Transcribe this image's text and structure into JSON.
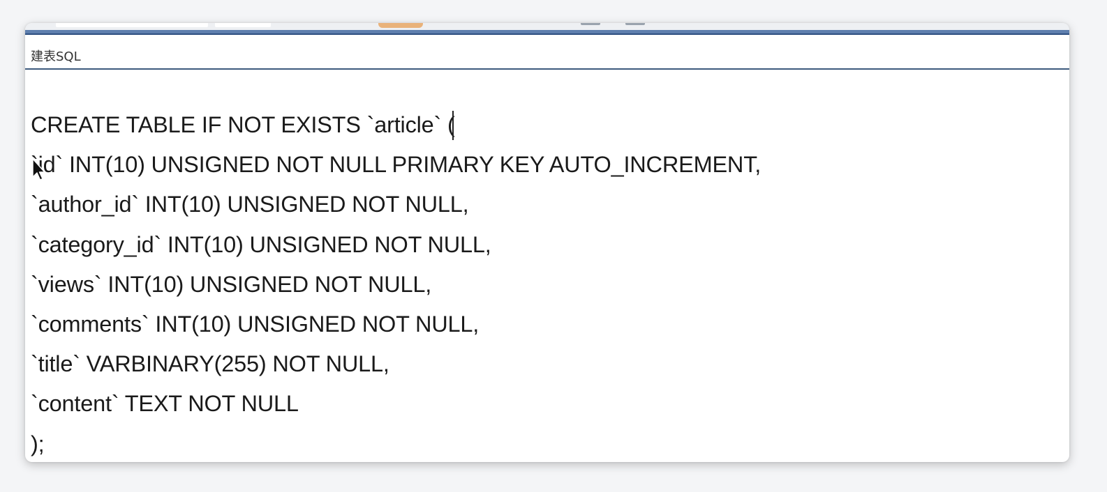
{
  "panel": {
    "title": "建表SQL"
  },
  "sql": {
    "lines": [
      "CREATE TABLE IF NOT EXISTS `article` (",
      "`id` INT(10) UNSIGNED NOT NULL PRIMARY KEY AUTO_INCREMENT,",
      "`author_id` INT(10) UNSIGNED NOT NULL,",
      "`category_id` INT(10) UNSIGNED NOT NULL,",
      "`views` INT(10) UNSIGNED NOT NULL,",
      "`comments` INT(10) UNSIGNED NOT NULL,",
      "`title` VARBINARY(255) NOT NULL,",
      "`content` TEXT NOT NULL",
      ");"
    ]
  },
  "icons": {
    "pointer": "mouse-pointer-icon",
    "caret": "text-cursor"
  },
  "colors": {
    "accent_rule": "#5f7fae",
    "header_border": "#3d5a7d",
    "tab_highlight": "#e9b27a"
  }
}
